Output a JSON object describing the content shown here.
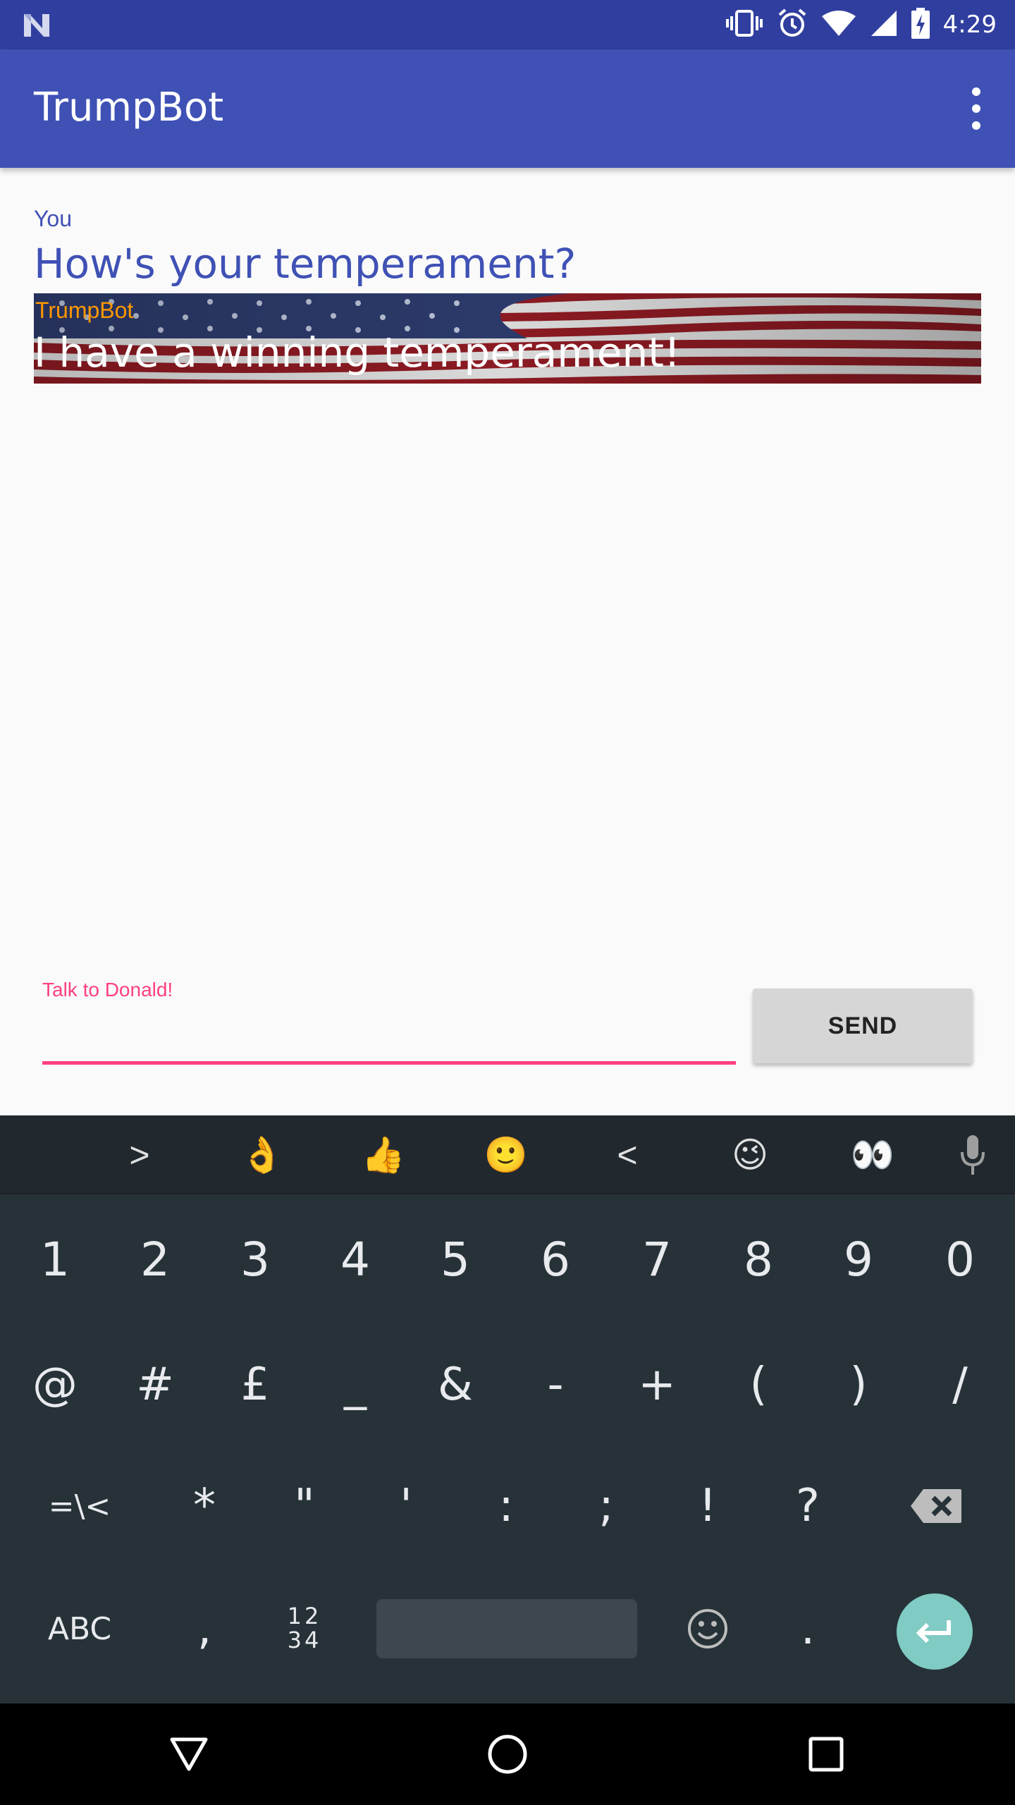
{
  "status_bar": {
    "time": "4:29",
    "icons": [
      "n-logo-icon",
      "vibrate-icon",
      "alarm-icon",
      "wifi-icon",
      "signal-icon",
      "battery-charging-icon"
    ]
  },
  "app_bar": {
    "title": "TrumpBot",
    "menu_icon": "overflow-menu-icon"
  },
  "chat": {
    "messages": [
      {
        "sender": "You",
        "text": "How's your temperament?"
      },
      {
        "sender": "TrumpBot",
        "text": "I have a winning temperament!",
        "background": "us-flag-image"
      }
    ]
  },
  "input": {
    "label": "Talk to Donald!",
    "value": "",
    "send_label": "SEND"
  },
  "keyboard": {
    "suggestions": [
      ">",
      "👌",
      "👍",
      "🙂",
      "<",
      "😉",
      "👀"
    ],
    "mic_icon": "microphone-icon",
    "row1": [
      "1",
      "2",
      "3",
      "4",
      "5",
      "6",
      "7",
      "8",
      "9",
      "0"
    ],
    "row2": [
      "@",
      "#",
      "£",
      "_",
      "&",
      "-",
      "+",
      "(",
      ")",
      "/"
    ],
    "row3": [
      "=\\<",
      "*",
      "\"",
      "'",
      ":",
      ";",
      "!",
      "?"
    ],
    "row3_backspace": "backspace-icon",
    "row4": {
      "abc": "ABC",
      "comma": ",",
      "numpad_top": "12",
      "numpad_bottom": "34",
      "emoji_icon": "emoji-icon",
      "period": ".",
      "enter_icon": "enter-icon"
    }
  },
  "nav_bar": {
    "icons": [
      "back-icon",
      "home-icon",
      "recents-icon"
    ]
  },
  "colors": {
    "status_bar": "#303f9f",
    "primary": "#3f51b5",
    "accent": "#ff4081",
    "bot_label": "#ff9800",
    "keyboard": "#263238",
    "enter_key": "#80cbc4"
  }
}
